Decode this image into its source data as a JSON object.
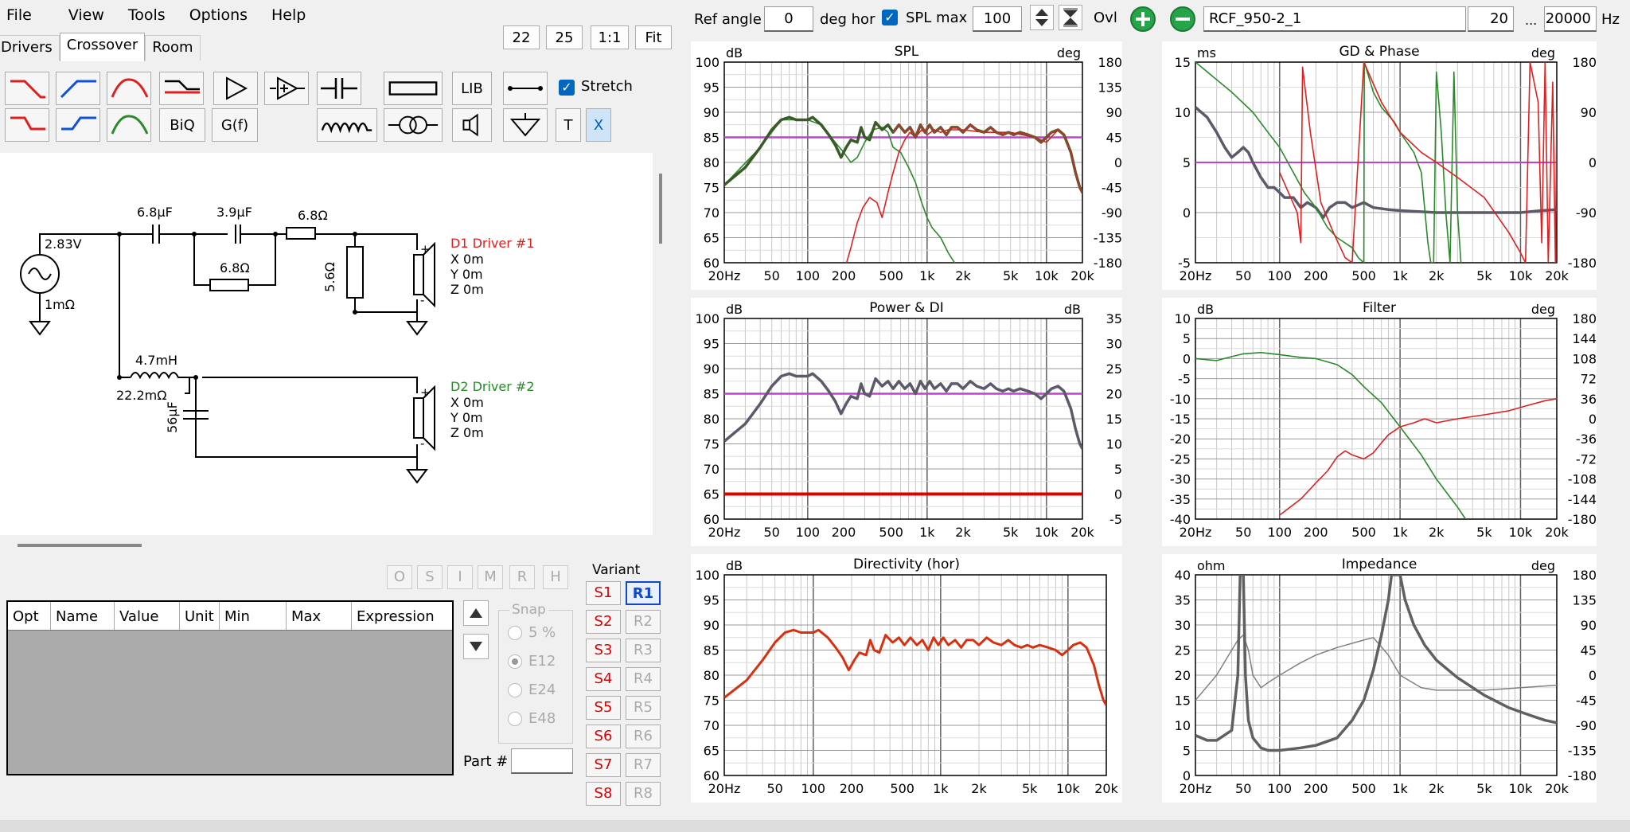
{
  "menu": [
    "File",
    "View",
    "Tools",
    "Options",
    "Help"
  ],
  "tabs": [
    "Drivers",
    "Crossover",
    "Room"
  ],
  "zoom_buttons": [
    "22",
    "25",
    "1:1",
    "Fit"
  ],
  "toolbar": {
    "lib": "LIB",
    "stretch": "Stretch",
    "biq": "BiQ",
    "gf": "G(f)",
    "t": "T",
    "x": "X"
  },
  "top": {
    "ref_angle_label": "Ref angle",
    "ref_angle": "0",
    "deg_hor": "deg hor",
    "spl_max_label": "SPL max",
    "spl_max": "100",
    "ovl": "Ovl",
    "name": "RCF_950-2_1",
    "f_min": "20",
    "dots": "...",
    "f_max": "20000",
    "hz": "Hz"
  },
  "schematic": {
    "source_v": "2.83V",
    "source_r": "1mΩ",
    "c1": "6.8µF",
    "c2": "3.9µF",
    "r1": "6.8Ω",
    "r2": "6.8Ω",
    "r3": "5.6Ω",
    "l1": "4.7mH",
    "l1r": "22.2mΩ",
    "c3": "56µF",
    "d1": "D1 Driver #1",
    "d2": "D2 Driver #2",
    "x": "X 0m",
    "y": "Y 0m",
    "z": "Z 0m",
    "plus": "+",
    "minus": "-"
  },
  "lock_buttons": [
    "O",
    "S",
    "I",
    "M",
    "R",
    "H"
  ],
  "table_headers": [
    "Opt",
    "Name",
    "Value",
    "Unit",
    "Min",
    "Max",
    "Expression"
  ],
  "snap": {
    "label": "Snap",
    "options": [
      "5 %",
      "E12",
      "E24",
      "E48"
    ],
    "selected": "E12"
  },
  "part_label": "Part #",
  "variant": {
    "label": "Variant",
    "s": [
      "S1",
      "S2",
      "S3",
      "S4",
      "S5",
      "S6",
      "S7",
      "S8"
    ],
    "r": [
      "R1",
      "R2",
      "R3",
      "R4",
      "R5",
      "R6",
      "R7",
      "R8"
    ],
    "selected": "R1"
  },
  "freq_ticks": [
    "20Hz",
    "50",
    "100",
    "200",
    "500",
    "1k",
    "2k",
    "5k",
    "10k",
    "20k"
  ],
  "charts": {
    "spl": {
      "title": "SPL",
      "left_unit": "dB",
      "right_unit": "deg",
      "left": [
        "100",
        "95",
        "90",
        "85",
        "80",
        "75",
        "70",
        "65",
        "60"
      ],
      "right": [
        "180",
        "135",
        "90",
        "45",
        "0",
        "-45",
        "-90",
        "-135",
        "-180"
      ]
    },
    "gd": {
      "title": "GD & Phase",
      "left_unit": "ms",
      "right_unit": "deg",
      "left": [
        "15",
        "10",
        "5",
        "0",
        "-5"
      ],
      "right": [
        "180",
        "90",
        "0",
        "-90",
        "-180"
      ]
    },
    "power": {
      "title": "Power & DI",
      "left_unit": "dB",
      "right_unit": "dB",
      "left": [
        "100",
        "95",
        "90",
        "85",
        "80",
        "75",
        "70",
        "65",
        "60"
      ],
      "right": [
        "35",
        "30",
        "25",
        "20",
        "15",
        "10",
        "5",
        "0",
        "-5"
      ]
    },
    "filter": {
      "title": "Filter",
      "left_unit": "dB",
      "right_unit": "deg",
      "left": [
        "10",
        "5",
        "0",
        "-5",
        "-10",
        "-15",
        "-20",
        "-25",
        "-30",
        "-35",
        "-40"
      ],
      "right": [
        "180",
        "144",
        "108",
        "72",
        "36",
        "0",
        "-36",
        "-72",
        "-108",
        "-144",
        "-180"
      ]
    },
    "dir": {
      "title": "Directivity (hor)",
      "left_unit": "dB",
      "left": [
        "100",
        "95",
        "90",
        "85",
        "80",
        "75",
        "70",
        "65",
        "60"
      ]
    },
    "imp": {
      "title": "Impedance",
      "left_unit": "ohm",
      "right_unit": "deg",
      "left": [
        "40",
        "35",
        "30",
        "25",
        "20",
        "15",
        "10",
        "5",
        "0"
      ],
      "right": [
        "180",
        "135",
        "90",
        "45",
        "0",
        "-45",
        "-90",
        "-135",
        "-180"
      ]
    }
  },
  "colors": {
    "magenta": "#c040d0",
    "woofer": "#2a8a2a",
    "tweeter": "#e02020",
    "sum": "#5a5a6a",
    "dir": "#d83010"
  }
}
